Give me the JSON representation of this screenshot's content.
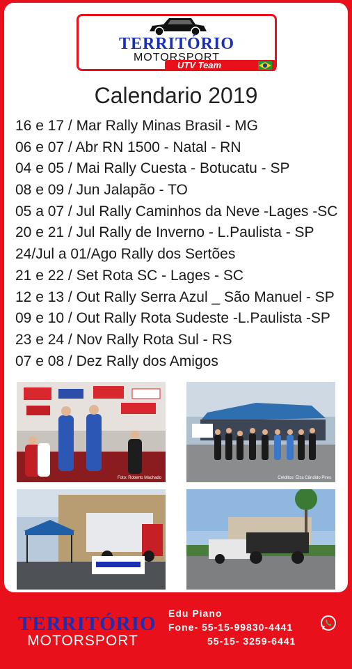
{
  "logo": {
    "line1": "TERRITÓRIO",
    "line2": "MOTORSPORT",
    "tag": "UTV Team"
  },
  "title": "Calendario 2019",
  "events": [
    "16 e 17 / Mar Rally Minas Brasil - MG",
    "06 e 07 / Abr  RN 1500 - Natal - RN",
    "04 e 05 / Mai  Rally Cuesta - Botucatu - SP",
    "08 e 09 / Jun  Jalapão - TO",
    "05 a 07 / Jul   Rally Caminhos da Neve -Lages -SC",
    "20 e 21 / Jul   Rally de Inverno - L.Paulista - SP",
    "24/Jul a 01/Ago Rally dos Sertões",
    "21 e 22 / Set  Rota SC - Lages - SC",
    "12 e 13 / Out  Rally Serra Azul _ São Manuel - SP",
    "09 e 10 / Out  Rally Rota Sudeste -L.Paulista -SP",
    "23 e 24 / Nov  Rally Rota Sul - RS",
    "07 e 08 / Dez  Rally dos Amigos"
  ],
  "photos": {
    "credit1": "Foto: Roberto Machado",
    "credit2": "Créditos: Elza Cândido Pires"
  },
  "footer": {
    "logo_line1": "TERRITÓRIO",
    "logo_line2": "MOTORSPORT",
    "name": "Edu Piano",
    "phone1": "Fone- 55-15-99830-4441",
    "phone2": "55-15- 3259-6441"
  },
  "colors": {
    "brand_red": "#e8101a",
    "brand_blue": "#1a2fb3"
  }
}
